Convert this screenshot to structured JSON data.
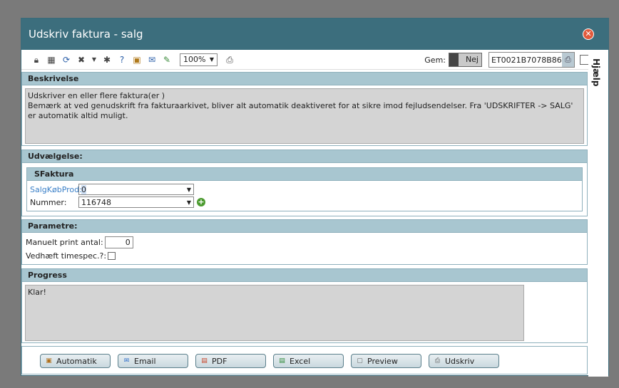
{
  "window": {
    "title": "Udskriv faktura - salg",
    "close_icon": "close-icon"
  },
  "toolbar": {
    "icons": [
      "lock-icon",
      "grid-icon",
      "refresh-icon",
      "tools-icon",
      "bug-icon",
      "help-icon",
      "save-icon",
      "mail-icon",
      "edit-icon",
      "print-icon"
    ],
    "zoom_value": "100%",
    "gem_label": "Gem:",
    "gem_toggle_text": "Nej",
    "printer_id": "ET0021B7078B86"
  },
  "side_help": {
    "label": "Hjælp"
  },
  "beskrivelse": {
    "header": "Beskrivelse",
    "line1": "Udskriver en eller flere faktura(er )",
    "line2": "Bemærk at ved genudskrift fra fakturaarkivet, bliver alt automatik deaktiveret for at sikre imod fejludsendelser. Fra 'UDSKRIFTER -> SALG' er automatik altid muligt."
  },
  "udvaelgelse": {
    "header": "Udvælgelse:",
    "subsection_header": "SFaktura",
    "field1_label": "SalgKøbProd:",
    "field1_value": "0",
    "field2_label": "Nummer:",
    "field2_value": "116748"
  },
  "parametre": {
    "header": "Parametre:",
    "print_antal_label": "Manuelt print antal:",
    "print_antal_value": "0",
    "timespec_label": "Vedhæft timespec.?:"
  },
  "progress": {
    "header": "Progress",
    "status": "Klar!"
  },
  "buttons": {
    "automatik": "Automatik",
    "email": "Email",
    "pdf": "PDF",
    "excel": "Excel",
    "preview": "Preview",
    "udskriv": "Udskriv"
  }
}
